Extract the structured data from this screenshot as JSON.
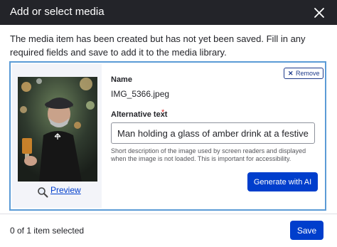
{
  "dialog": {
    "title": "Add or select media",
    "close_icon": "close-icon"
  },
  "notice": "The media item has been created but has not yet been saved. Fill in any required fields and save to add it to the media library.",
  "media_item": {
    "remove_label": "Remove",
    "remove_icon": "x-icon",
    "preview_label": "Preview",
    "preview_icon": "magnifier-icon",
    "name_label": "Name",
    "name_value": "IMG_5366.jpeg",
    "alt_label": "Alternative text",
    "required_mark": "*",
    "alt_value": "Man holding a glass of amber drink at a festive, illuminated outdoor market",
    "alt_help": "Short description of the image used by screen readers and displayed when the image is not loaded. This is important for accessibility.",
    "generate_label": "Generate with AI"
  },
  "footer": {
    "selected_text": "0 of 1 item selected",
    "save_label": "Save"
  },
  "colors": {
    "titlebar": "#232429",
    "primary": "#003ecc",
    "focus_border": "#5b9bd6",
    "panel_bg": "#f3f4f9",
    "required": "#d72222"
  }
}
